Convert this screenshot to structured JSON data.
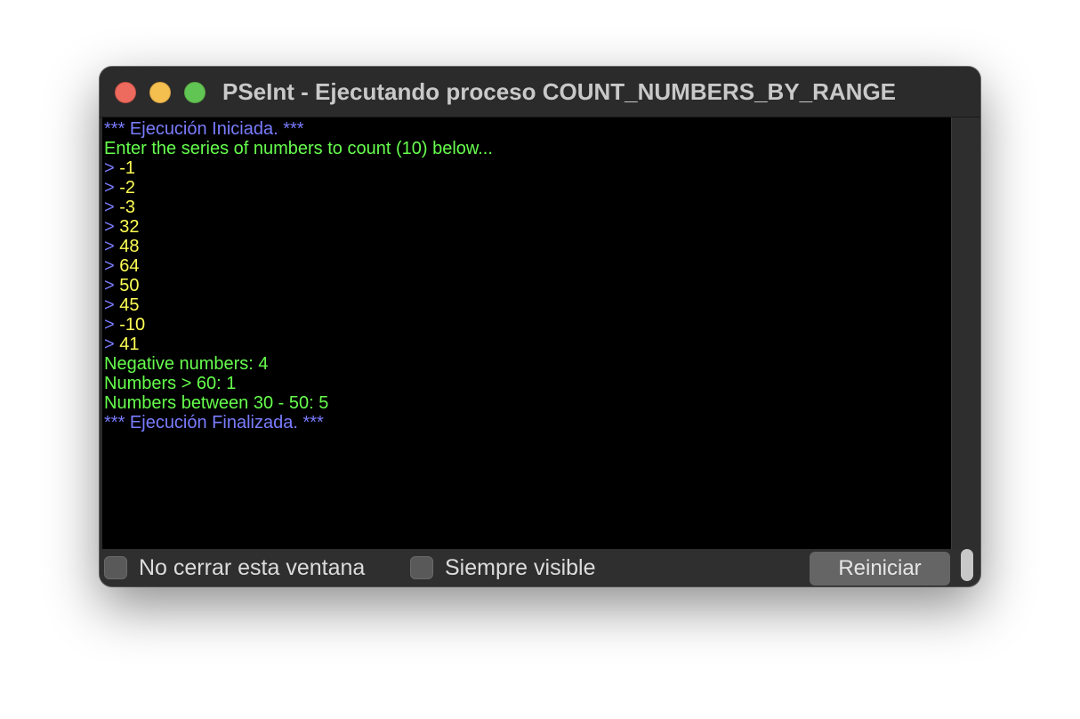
{
  "window": {
    "title": "PSeInt - Ejecutando proceso COUNT_NUMBERS_BY_RANGE"
  },
  "console": {
    "lines": [
      {
        "segments": [
          {
            "text": "*** Ejecución Iniciada. ***",
            "color": "blue"
          }
        ]
      },
      {
        "segments": [
          {
            "text": "Enter the series of numbers to count (10) below...",
            "color": "green"
          }
        ]
      },
      {
        "segments": [
          {
            "text": "> ",
            "color": "blue"
          },
          {
            "text": "-1",
            "color": "yellow"
          }
        ]
      },
      {
        "segments": [
          {
            "text": "> ",
            "color": "blue"
          },
          {
            "text": "-2",
            "color": "yellow"
          }
        ]
      },
      {
        "segments": [
          {
            "text": "> ",
            "color": "blue"
          },
          {
            "text": "-3",
            "color": "yellow"
          }
        ]
      },
      {
        "segments": [
          {
            "text": "> ",
            "color": "blue"
          },
          {
            "text": "32",
            "color": "yellow"
          }
        ]
      },
      {
        "segments": [
          {
            "text": "> ",
            "color": "blue"
          },
          {
            "text": "48",
            "color": "yellow"
          }
        ]
      },
      {
        "segments": [
          {
            "text": "> ",
            "color": "blue"
          },
          {
            "text": "64",
            "color": "yellow"
          }
        ]
      },
      {
        "segments": [
          {
            "text": "> ",
            "color": "blue"
          },
          {
            "text": "50",
            "color": "yellow"
          }
        ]
      },
      {
        "segments": [
          {
            "text": "> ",
            "color": "blue"
          },
          {
            "text": "45",
            "color": "yellow"
          }
        ]
      },
      {
        "segments": [
          {
            "text": "> ",
            "color": "blue"
          },
          {
            "text": "-10",
            "color": "yellow"
          }
        ]
      },
      {
        "segments": [
          {
            "text": "> ",
            "color": "blue"
          },
          {
            "text": "41",
            "color": "yellow"
          }
        ]
      },
      {
        "segments": [
          {
            "text": "Negative numbers: 4",
            "color": "green"
          }
        ]
      },
      {
        "segments": [
          {
            "text": "Numbers > 60: 1",
            "color": "green"
          }
        ]
      },
      {
        "segments": [
          {
            "text": "Numbers between 30 - 50: 5",
            "color": "green"
          }
        ]
      },
      {
        "segments": [
          {
            "text": "*** Ejecución Finalizada. ***",
            "color": "blue"
          }
        ]
      }
    ]
  },
  "bottom": {
    "keep_open_label": "No cerrar esta ventana",
    "keep_open_checked": false,
    "always_visible_label": "Siempre visible",
    "always_visible_checked": false,
    "restart_label": "Reiniciar"
  },
  "colors": {
    "blue": "#7a7cff",
    "green": "#66ff4d",
    "yellow": "#ffff55",
    "console_bg": "#000000"
  }
}
